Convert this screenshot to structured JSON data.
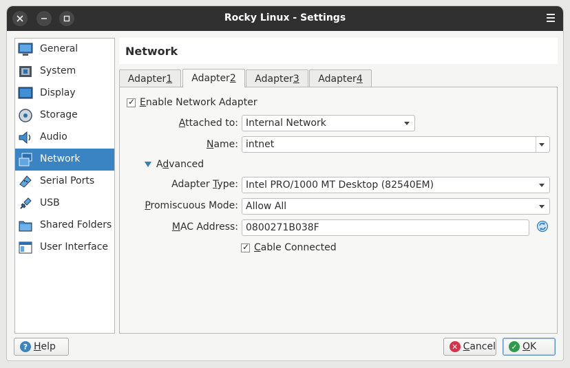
{
  "window": {
    "title": "Rocky Linux - Settings"
  },
  "sidebar": {
    "items": [
      {
        "label": "General",
        "icon": "monitor-icon"
      },
      {
        "label": "System",
        "icon": "chip-icon"
      },
      {
        "label": "Display",
        "icon": "display-icon"
      },
      {
        "label": "Storage",
        "icon": "disk-icon"
      },
      {
        "label": "Audio",
        "icon": "speaker-icon"
      },
      {
        "label": "Network",
        "icon": "network-icon",
        "active": true
      },
      {
        "label": "Serial Ports",
        "icon": "serial-port-icon"
      },
      {
        "label": "USB",
        "icon": "usb-icon"
      },
      {
        "label": "Shared Folders",
        "icon": "folder-icon"
      },
      {
        "label": "User Interface",
        "icon": "window-icon"
      }
    ]
  },
  "section": {
    "title": "Network"
  },
  "tabs": [
    {
      "prefix": "Adapter ",
      "mnemonic": "1"
    },
    {
      "prefix": "Adapter ",
      "mnemonic": "2",
      "active": true
    },
    {
      "prefix": "Adapter ",
      "mnemonic": "3"
    },
    {
      "prefix": "Adapter ",
      "mnemonic": "4"
    }
  ],
  "adapter": {
    "enable": {
      "mnemonic": "E",
      "rest": "nable Network Adapter",
      "checked": true
    },
    "attached_to": {
      "mnemonic": "A",
      "rest": "ttached to:",
      "value": "Internal Network"
    },
    "name": {
      "mnemonic": "N",
      "rest": "ame:",
      "value": "intnet"
    },
    "advanced": {
      "pre": "A",
      "mnemonic": "d",
      "rest": "vanced"
    },
    "adapter_type": {
      "pre": "Adapter ",
      "mnemonic": "T",
      "rest": "ype:",
      "value": "Intel PRO/1000 MT Desktop (82540EM)"
    },
    "promiscuous": {
      "mnemonic": "P",
      "rest": "romiscuous Mode:",
      "value": "Allow All"
    },
    "mac": {
      "mnemonic": "M",
      "rest": "AC Address:",
      "value": "0800271B038F"
    },
    "cable": {
      "mnemonic": "C",
      "rest": "able Connected",
      "checked": true
    }
  },
  "buttons": {
    "help": {
      "mnemonic": "H",
      "rest": "elp"
    },
    "cancel": {
      "mnemonic": "C",
      "rest": "ancel"
    },
    "ok": {
      "mnemonic": "O",
      "rest": "K"
    }
  },
  "colors": {
    "accent": "#3b84c4",
    "titlebar": "#303030",
    "cancel": "#d8324a",
    "ok": "#2e9a4c",
    "help": "#3b84c4"
  }
}
